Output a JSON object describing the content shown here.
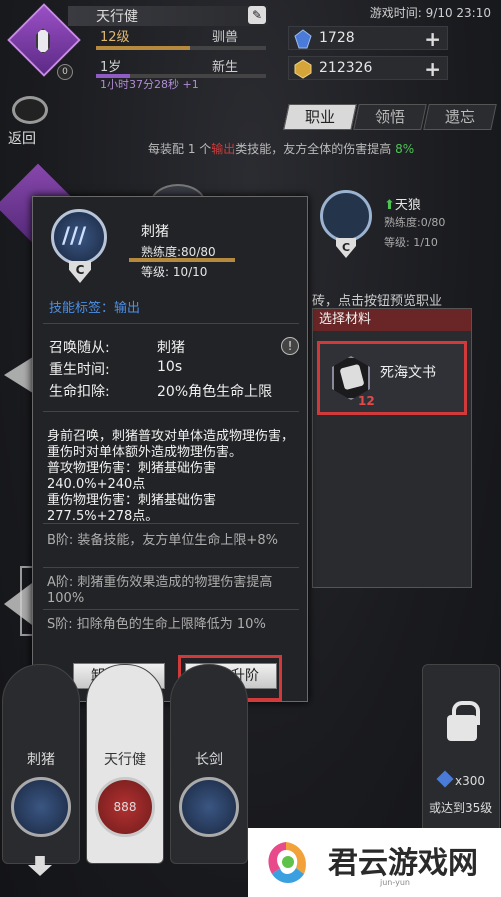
{
  "header": {
    "player_name": "天行健",
    "level": "12级",
    "class_title": "驯兽",
    "age": "1岁",
    "age_status": "新生",
    "timer": "1小时37分28秒 +1",
    "level_badge": "0",
    "game_time": "游戏时间: 9/10 23:10",
    "back_label": "返回"
  },
  "resources": [
    {
      "icon": "blue-gem-icon",
      "value": "1728",
      "color": "#4a7bd8"
    },
    {
      "icon": "gold-coin-icon",
      "value": "212326",
      "color": "#d6a53a"
    }
  ],
  "tabs": [
    {
      "label": "职业",
      "active": true
    },
    {
      "label": "领悟",
      "active": false
    },
    {
      "label": "遗忘",
      "active": false
    }
  ],
  "bonus": {
    "pre": "每装配 1 个",
    "red": "输出",
    "mid": "类技能，友方全体的伤害提高",
    "green": "8%"
  },
  "background_skill": {
    "name": "天狼",
    "proficiency": "熟练度:0/80",
    "level": "等级: 1/10",
    "grade": "C",
    "hint": "砖，点击按钮预览职业"
  },
  "material_panel": {
    "header": "选择材料",
    "item_name": "死海文书",
    "item_count": "12"
  },
  "popup": {
    "skill_name": "刺猪",
    "proficiency": "熟练度:80/80",
    "level": "等级: 10/10",
    "grade": "C",
    "tag_label": "技能标签：",
    "tag_value": "输出",
    "rows": [
      {
        "label": "召唤随从:",
        "value": "刺猪"
      },
      {
        "label": "重生时间:",
        "value": "10s"
      },
      {
        "label": "生命扣除:",
        "value": "20%角色生命上限"
      }
    ],
    "description": "身前召唤，刺猪普攻对单体造成物理伤害，重伤时对单体额外造成物理伤害。",
    "normal_damage": "普攻物理伤害：刺猪基础伤害240.0%+240点",
    "heavy_damage": "重伤物理伤害：刺猪基础伤害277.5%+278点。",
    "tiers": [
      "B阶: 装备技能，友方单位生命上限+8%",
      "A阶: 刺猪重伤效果造成的物理伤害提高100%",
      "S阶: 扣除角色的生命上限降低为 10%"
    ],
    "unequip_label": "卸载技能",
    "upgrade_label": "技能升阶"
  },
  "bottom_cards": [
    {
      "label": "刺猪",
      "style": "dark"
    },
    {
      "label": "天行健",
      "style": "light",
      "circle_text": "888"
    },
    {
      "label": "长剑",
      "style": "dark"
    }
  ],
  "lock_card": {
    "cost": "x300",
    "unlock_text": "或达到35级"
  },
  "watermark": {
    "text": "君云游戏网",
    "sub": "jun-yun"
  }
}
